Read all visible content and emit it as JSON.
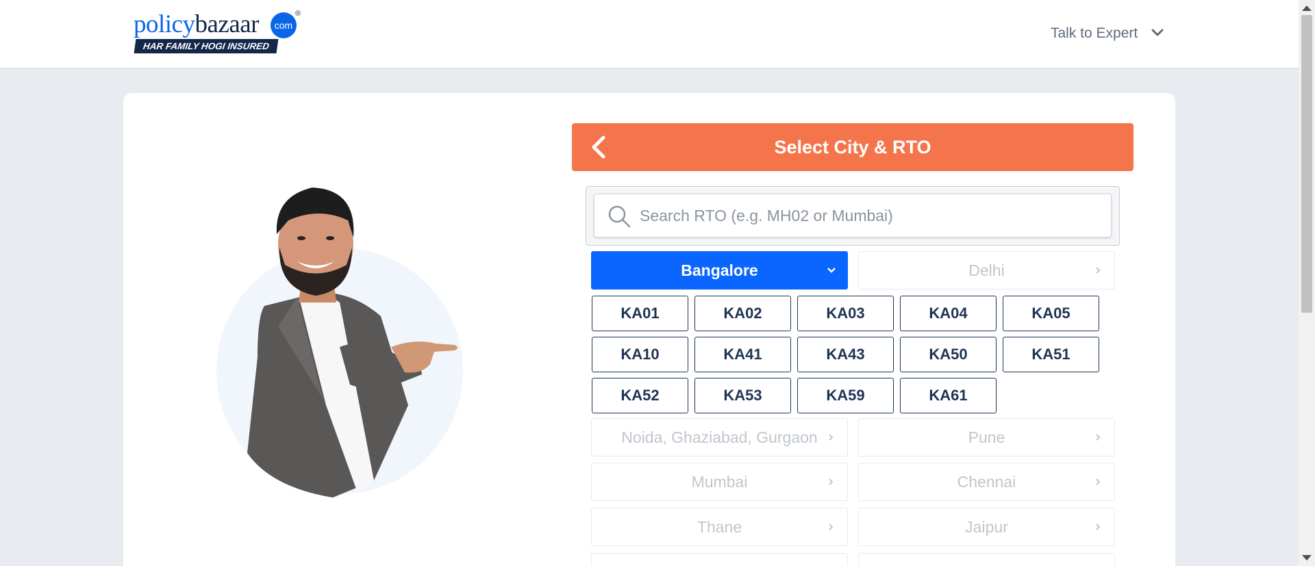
{
  "header": {
    "logo": {
      "word_left": "policy",
      "word_right": "bazaar",
      "com": "com",
      "reg": "®",
      "tagline": "HAR FAMILY HOGI INSURED"
    },
    "talk_label": "Talk to Expert"
  },
  "panel": {
    "title": "Select City & RTO",
    "search_placeholder": "Search RTO (e.g. MH02 or Mumbai)"
  },
  "selected_city": {
    "label": "Bangalore",
    "rto_codes": [
      "KA01",
      "KA02",
      "KA03",
      "KA04",
      "KA05",
      "KA10",
      "KA41",
      "KA43",
      "KA50",
      "KA51",
      "KA52",
      "KA53",
      "KA59",
      "KA61"
    ]
  },
  "cities": [
    "Bangalore",
    "Delhi",
    "Noida, Ghaziabad, Gurgaon",
    "Pune",
    "Mumbai",
    "Chennai",
    "Thane",
    "Jaipur"
  ],
  "colors": {
    "accent_orange": "#f4754c",
    "active_blue": "#0a66ff",
    "navy": "#13274a",
    "rto_border": "#1e3354",
    "inactive_text": "#c0c6cd"
  }
}
